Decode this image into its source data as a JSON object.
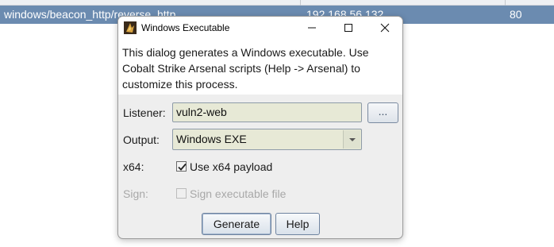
{
  "background_table": {
    "selected_row": {
      "payload": "windows/beacon_http/reverse_http",
      "host": "192.168.56.132",
      "port": "80"
    }
  },
  "dialog": {
    "title": "Windows Executable",
    "description": "This dialog generates a Windows executable. Use Cobalt Strike Arsenal scripts (Help -> Arsenal) to customize this process.",
    "listener": {
      "label": "Listener:",
      "value": "vuln2-web",
      "browse_label": "..."
    },
    "output": {
      "label": "Output:",
      "selected": "Windows EXE"
    },
    "x64": {
      "label": "x64:",
      "checkbox_label": "Use x64 payload",
      "checked": true
    },
    "sign": {
      "label": "Sign:",
      "checkbox_label": "Sign executable file",
      "checked": false,
      "enabled": false
    },
    "buttons": {
      "generate": "Generate",
      "help": "Help"
    }
  },
  "icons": [
    "cobalt-strike-icon",
    "minimize-icon",
    "maximize-icon",
    "close-icon",
    "dropdown-arrow-icon",
    "checkmark-icon"
  ]
}
